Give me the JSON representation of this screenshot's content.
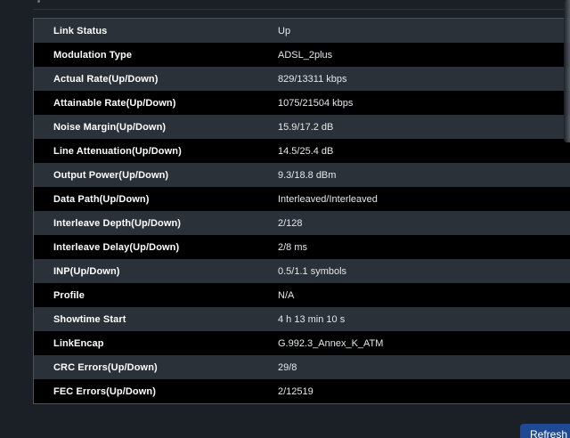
{
  "status_table": {
    "rows": [
      {
        "label": "Link Status",
        "value": "Up"
      },
      {
        "label": "Modulation Type",
        "value": "ADSL_2plus"
      },
      {
        "label": "Actual Rate(Up/Down)",
        "value": "829/13311 kbps"
      },
      {
        "label": "Attainable Rate(Up/Down)",
        "value": "1075/21504 kbps"
      },
      {
        "label": "Noise Margin(Up/Down)",
        "value": "15.9/17.2 dB"
      },
      {
        "label": "Line Attenuation(Up/Down)",
        "value": "14.5/25.4 dB"
      },
      {
        "label": "Output Power(Up/Down)",
        "value": "9.3/18.8 dBm"
      },
      {
        "label": "Data Path(Up/Down)",
        "value": "Interleaved/Interleaved"
      },
      {
        "label": "Interleave Depth(Up/Down)",
        "value": "2/128"
      },
      {
        "label": "Interleave Delay(Up/Down)",
        "value": "2/8 ms"
      },
      {
        "label": "INP(Up/Down)",
        "value": "0.5/1.1 symbols"
      },
      {
        "label": "Profile",
        "value": "N/A"
      },
      {
        "label": "Showtime Start",
        "value": "4 h 13 min 10 s"
      },
      {
        "label": "LinkEncap",
        "value": "G.992.3_Annex_K_ATM"
      },
      {
        "label": "CRC Errors(Up/Down)",
        "value": "29/8"
      },
      {
        "label": "FEC Errors(Up/Down)",
        "value": "2/12519"
      }
    ]
  },
  "actions": {
    "refresh_label": "Refresh"
  },
  "colors": {
    "page_bg": "#1b2026",
    "row_odd": "#2a3139",
    "row_even": "#000000",
    "button_bg": "#1f4a93"
  }
}
